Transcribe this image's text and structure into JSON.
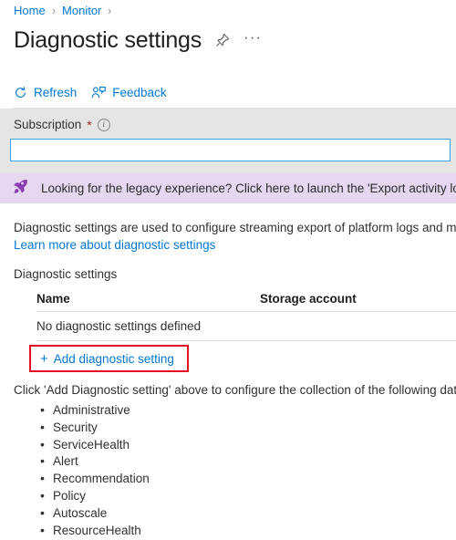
{
  "breadcrumb": {
    "items": [
      {
        "label": "Home"
      },
      {
        "label": "Monitor"
      }
    ],
    "separator": "›"
  },
  "header": {
    "title": "Diagnostic settings",
    "pin_icon": "pin-icon",
    "more_label": "···"
  },
  "toolbar": {
    "refresh_label": "Refresh",
    "feedback_label": "Feedback"
  },
  "subscription": {
    "label": "Subscription",
    "required_mark": "*",
    "info_glyph": "i",
    "value": "",
    "placeholder": ""
  },
  "banner": {
    "icon": "rocket-icon",
    "text": "Looking for the legacy experience? Click here to launch the 'Export activity log' blade",
    "background": "#e7d6f0",
    "icon_color": "#8a3fb0"
  },
  "description": {
    "text": "Diagnostic settings are used to configure streaming export of platform logs and metr",
    "learn_more": "Learn more about diagnostic settings"
  },
  "table": {
    "section_label": "Diagnostic settings",
    "columns": [
      "Name",
      "Storage account"
    ],
    "rows": [
      {
        "name": "No diagnostic settings defined",
        "storage_account": ""
      }
    ]
  },
  "add_setting": {
    "plus": "+",
    "label": "Add diagnostic setting",
    "highlight_color": "#e81123"
  },
  "following_data": {
    "intro": "Click 'Add Diagnostic setting' above to configure the collection of the following data:",
    "items": [
      "Administrative",
      "Security",
      "ServiceHealth",
      "Alert",
      "Recommendation",
      "Policy",
      "Autoscale",
      "ResourceHealth"
    ]
  },
  "colors": {
    "accent": "#0078d4",
    "required": "#a4262c",
    "panel_gray": "#e5e5e5"
  }
}
